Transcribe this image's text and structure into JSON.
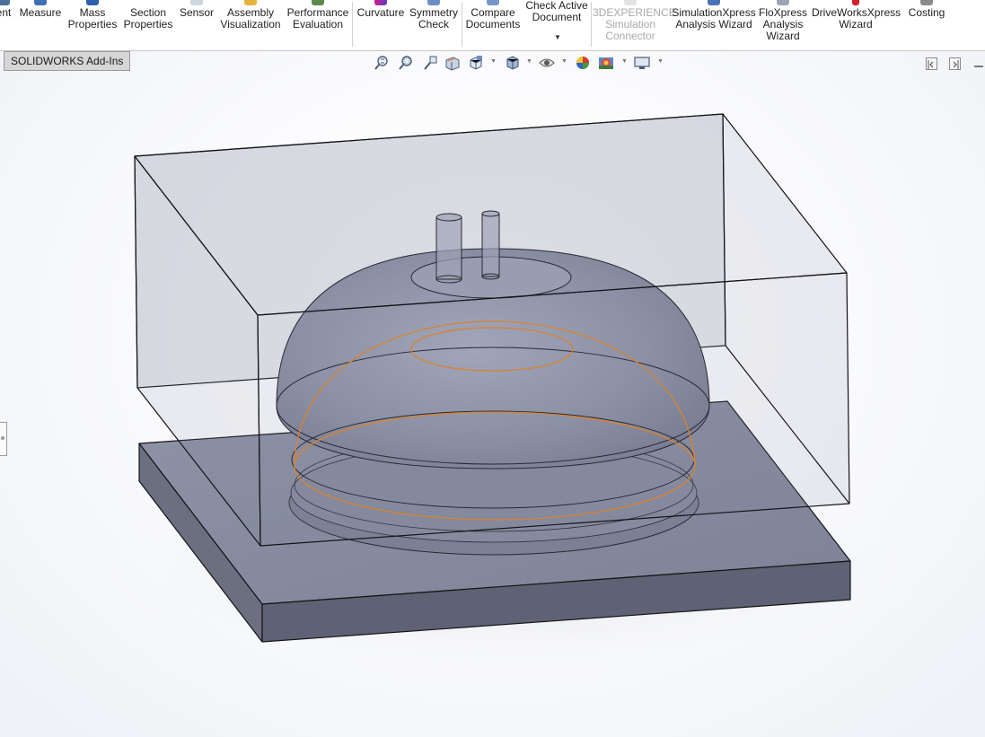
{
  "ribbon": {
    "buttons": [
      {
        "label": "ent",
        "icon": "truncated-icon",
        "disabled": false
      },
      {
        "label": "Measure",
        "icon": "measure-icon",
        "disabled": false
      },
      {
        "label": "Mass\nProperties",
        "icon": "mass-properties-icon",
        "disabled": false
      },
      {
        "label": "Section\nProperties",
        "icon": "section-properties-icon",
        "disabled": false
      },
      {
        "label": "Sensor",
        "icon": "sensor-icon",
        "disabled": false
      },
      {
        "label": "Assembly\nVisualization",
        "icon": "assembly-visualization-icon",
        "disabled": false
      },
      {
        "label": "Performance\nEvaluation",
        "icon": "performance-evaluation-icon",
        "disabled": false
      },
      {
        "label": "Curvature",
        "icon": "curvature-icon",
        "disabled": false
      },
      {
        "label": "Symmetry\nCheck",
        "icon": "symmetry-check-icon",
        "disabled": false
      },
      {
        "label": "Compare\nDocuments",
        "icon": "compare-documents-icon",
        "disabled": false
      },
      {
        "label": "Check Active\nDocument",
        "icon": "check-document-icon",
        "disabled": false
      },
      {
        "label": "3DEXPERIENCE\nSimulation\nConnector",
        "icon": "3dexperience-icon",
        "disabled": true
      },
      {
        "label": "SimulationXpress\nAnalysis Wizard",
        "icon": "simulationxpress-icon",
        "disabled": false
      },
      {
        "label": "FloXpress\nAnalysis\nWizard",
        "icon": "floxpress-icon",
        "disabled": false
      },
      {
        "label": "DriveWorksXpress\nWizard",
        "icon": "driveworksxpress-icon",
        "disabled": false
      },
      {
        "label": "Costing",
        "icon": "costing-icon",
        "disabled": false
      }
    ]
  },
  "tabs": {
    "active": "SOLIDWORKS Add-Ins"
  },
  "view_toolbar": {
    "icons": [
      "zoom-to-fit-icon",
      "zoom-to-area-icon",
      "previous-view-icon",
      "section-view-icon",
      "view-orientation-icon",
      "display-style-icon",
      "hide-show-items-icon",
      "edit-appearance-icon",
      "apply-scene-icon",
      "view-settings-icon"
    ]
  },
  "colors": {
    "accent_orange": "#e8831c",
    "model_edge": "#141418",
    "base_plate": "#8e91a4"
  }
}
